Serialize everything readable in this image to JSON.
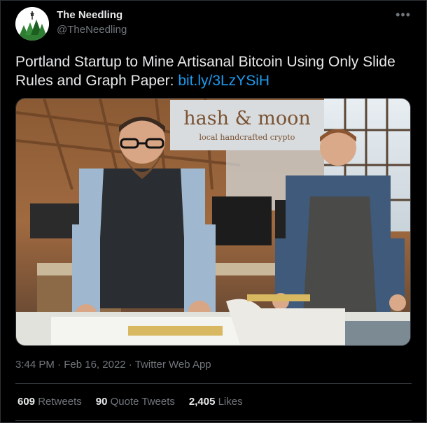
{
  "author": {
    "name": "The Needling",
    "handle": "@TheNeedling"
  },
  "tweet": {
    "text": "Portland Startup to Mine Artisanal Bitcoin Using Only Slide Rules and Graph Paper: ",
    "link": "bit.ly/3LzYSiH"
  },
  "media": {
    "sign_title": "hash & moon",
    "sign_subtitle": "local handcrafted crypto"
  },
  "meta": {
    "time": "3:44 PM",
    "date": "Feb 16, 2022",
    "source": "Twitter Web App",
    "separator": "·"
  },
  "stats": {
    "retweets_count": "609",
    "retweets_label": "Retweets",
    "quotes_count": "90",
    "quotes_label": "Quote Tweets",
    "likes_count": "2,405",
    "likes_label": "Likes"
  },
  "icons": {
    "more": "more-options-icon",
    "avatar": "tree-logo"
  },
  "colors": {
    "background": "#000000",
    "text": "#e7e9ea",
    "muted": "#71767b",
    "link": "#1d9bf0",
    "border": "#2f3336"
  }
}
